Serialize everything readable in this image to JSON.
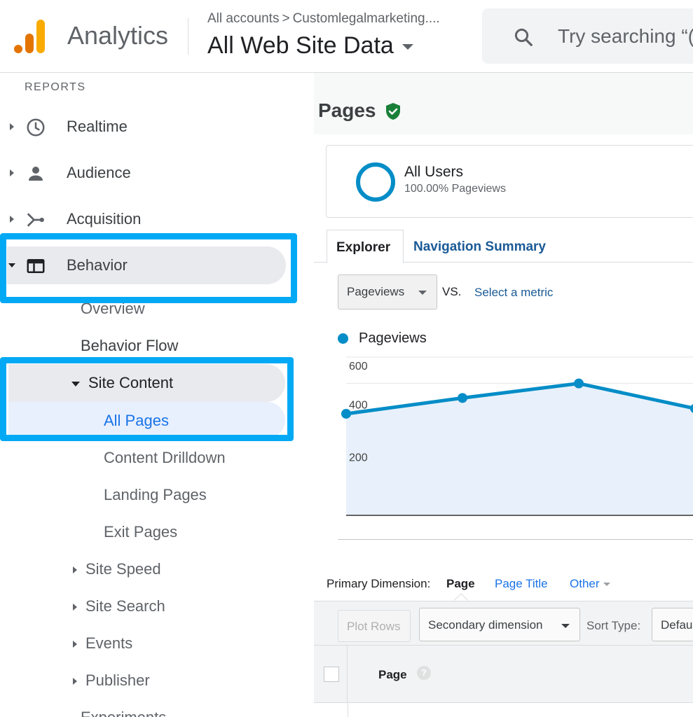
{
  "header": {
    "app_name": "Analytics",
    "breadcrumb_accounts": "All accounts",
    "breadcrumb_sep": ">",
    "breadcrumb_property": "Customlegalmarketing....",
    "view_name": "All Web Site Data",
    "search_placeholder": "Try searching “("
  },
  "sidebar": {
    "section_label": "REPORTS",
    "items": [
      {
        "label": "Realtime",
        "icon": "clock-icon"
      },
      {
        "label": "Audience",
        "icon": "person-icon"
      },
      {
        "label": "Acquisition",
        "icon": "acquisition-icon"
      },
      {
        "label": "Behavior",
        "icon": "behavior-icon"
      }
    ],
    "behavior_sub": {
      "overview": "Overview",
      "behavior_flow": "Behavior Flow",
      "site_content": "Site Content",
      "all_pages": "All Pages",
      "content_drilldown": "Content Drilldown",
      "landing_pages": "Landing Pages",
      "exit_pages": "Exit Pages",
      "site_speed": "Site Speed",
      "site_search": "Site Search",
      "events": "Events",
      "publisher": "Publisher",
      "experiments": "Experiments"
    }
  },
  "main": {
    "page_title": "Pages",
    "segment": {
      "name": "All Users",
      "sub": "100.00% Pageviews"
    },
    "tabs": {
      "explorer": "Explorer",
      "navigation_summary": "Navigation Summary"
    },
    "metric_select": "Pageviews",
    "vs_label": "VS.",
    "select_metric": "Select a metric",
    "legend_label": "Pageviews",
    "primary_dimension_label": "Primary Dimension:",
    "primary_dimension_page": "Page",
    "primary_dimension_page_title": "Page Title",
    "primary_dimension_other": "Other",
    "plot_rows": "Plot Rows",
    "secondary_dimension": "Secondary dimension",
    "sort_type_label": "Sort Type:",
    "sort_type_value": "Default",
    "table_header_page": "Page",
    "help_icon_text": "?"
  },
  "colors": {
    "accent": "#058dc7",
    "highlight": "#03a9f4",
    "link": "#1a73e8",
    "shield": "#188038"
  },
  "chart_data": {
    "type": "area",
    "series": [
      {
        "name": "Pageviews",
        "values": [
          385,
          445,
          500,
          405
        ]
      }
    ],
    "ytick_labels": [
      "600",
      "400",
      "200"
    ],
    "ylim": [
      0,
      600
    ],
    "grid": true
  }
}
